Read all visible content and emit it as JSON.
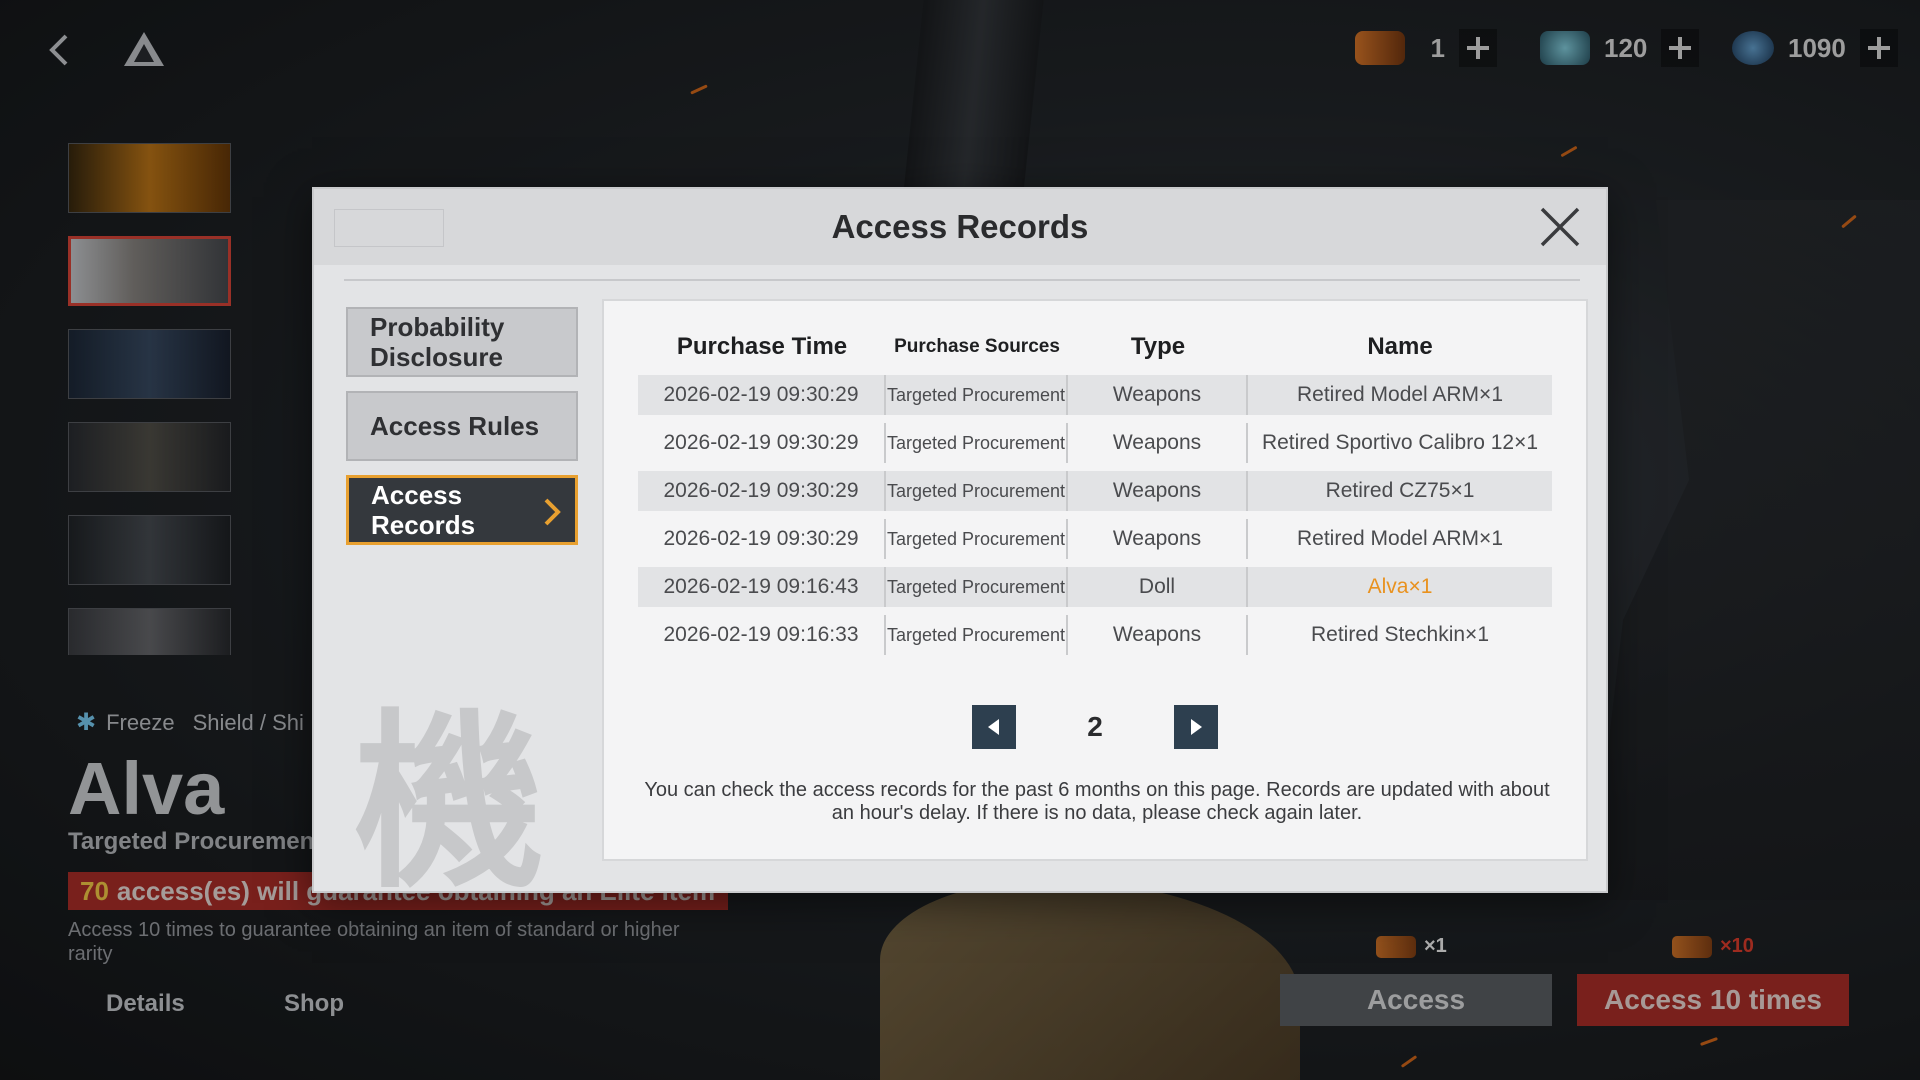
{
  "currency": [
    {
      "icon": "ticket-icon",
      "value": "1"
    },
    {
      "icon": "crystal-icon",
      "value": "120"
    },
    {
      "icon": "coin-icon",
      "value": "1090"
    }
  ],
  "character": {
    "tags": [
      "Freeze",
      "Shield / Shi"
    ],
    "name": "Alva",
    "subtitle": "Targeted Procuremen",
    "guarantee_count": "70",
    "guarantee_text": "access(es) will guarantee obtaining an Elite item",
    "guarantee_note": "Access 10 times to guarantee obtaining an item of standard or higher rarity"
  },
  "bottom_links": {
    "details": "Details",
    "shop": "Shop"
  },
  "access": {
    "single_cost": "×1",
    "ten_cost": "×10",
    "single_label": "Access",
    "ten_label": "Access 10 times"
  },
  "modal": {
    "title": "Access Records",
    "sidebar": [
      "Probability Disclosure",
      "Access Rules",
      "Access Records"
    ],
    "side_char": "機",
    "columns": [
      "Purchase Time",
      "Purchase Sources",
      "Type",
      "Name"
    ],
    "rows": [
      {
        "time": "2026-02-19 09:30:29",
        "source": "Targeted Procurement",
        "type": "Weapons",
        "name": "Retired Model ARM×1"
      },
      {
        "time": "2026-02-19 09:30:29",
        "source": "Targeted Procurement",
        "type": "Weapons",
        "name": "Retired Sportivo Calibro 12×1"
      },
      {
        "time": "2026-02-19 09:30:29",
        "source": "Targeted Procurement",
        "type": "Weapons",
        "name": "Retired CZ75×1"
      },
      {
        "time": "2026-02-19 09:30:29",
        "source": "Targeted Procurement",
        "type": "Weapons",
        "name": "Retired Model ARM×1"
      },
      {
        "time": "2026-02-19 09:16:43",
        "source": "Targeted Procurement",
        "type": "Doll",
        "name": "Alva×1"
      },
      {
        "time": "2026-02-19 09:16:33",
        "source": "Targeted Procurement",
        "type": "Weapons",
        "name": "Retired Stechkin×1"
      }
    ],
    "page": "2",
    "note": "You can check the access records for the past 6 months on this page. Records are updated with about an hour's delay. If there is no data, please check again later.",
    "colors": {
      "active_border": "#e8a030",
      "highlight_name": "#e9921f",
      "pager_button": "#2d3f4f"
    }
  }
}
